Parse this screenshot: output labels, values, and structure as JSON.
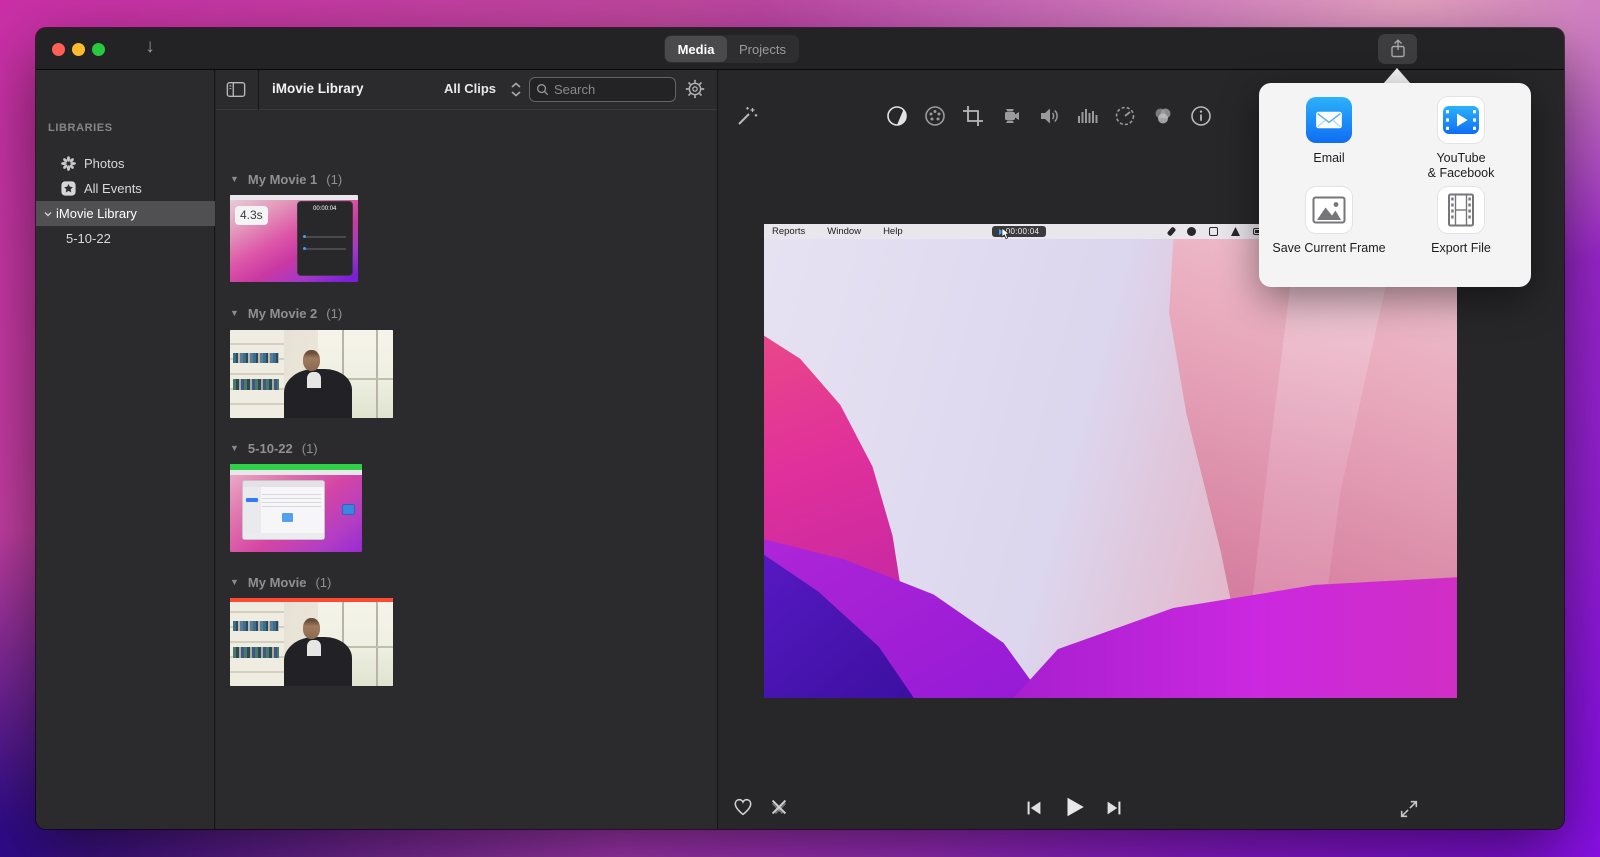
{
  "titlebar": {
    "tabs": [
      {
        "label": "Media"
      },
      {
        "label": "Projects"
      }
    ],
    "active_tab": "Media",
    "download_arrow_glyph": "↓"
  },
  "sidebar": {
    "header": "LIBRARIES",
    "items": [
      {
        "label": "Photos",
        "icon": "photos-pinwheel-icon"
      },
      {
        "label": "All Events",
        "icon": "star-icon"
      },
      {
        "label": "iMovie Library",
        "icon": "chevron-down-icon",
        "selected": true
      },
      {
        "label": "5-10-22",
        "indented": true
      }
    ],
    "star_glyph": "★"
  },
  "media": {
    "title": "iMovie Library",
    "filter_label": "All Clips",
    "search_placeholder": "Search",
    "disclosure_glyph": "▼",
    "sections": [
      {
        "name": "My Movie 1",
        "count": "(1)"
      },
      {
        "name": "My Movie 2",
        "count": "(1)"
      },
      {
        "name": "5-10-22",
        "count": "(1)"
      },
      {
        "name": "My Movie",
        "count": "(1)"
      }
    ],
    "clip1_duration_badge": "4.3s",
    "clip1_window_timer": "00:00:04",
    "used_clip_stripe_color": "#ff4a31",
    "recorded_clip_stripe_color": "#30d148"
  },
  "viewer": {
    "toolbar_icons": [
      "enhance-wand",
      "color-balance",
      "color-palette",
      "crop",
      "stabilization",
      "volume",
      "noise-equalizer",
      "speed",
      "clip-filter",
      "info"
    ],
    "preview": {
      "menus": [
        "Reports",
        "Window",
        "Help"
      ],
      "timer": "00:00:04"
    },
    "controls": [
      "favorite-heart",
      "reject-x",
      "previous-frame",
      "play",
      "next-frame",
      "fullscreen"
    ]
  },
  "share_popover": {
    "items": [
      {
        "label": "Email",
        "icon": "mail-icon"
      },
      {
        "label": "YouTube\n& Facebook",
        "icon": "youtube-facebook-icon"
      },
      {
        "label": "Save Current Frame",
        "icon": "save-frame-icon"
      },
      {
        "label": "Export File",
        "icon": "export-file-icon"
      }
    ]
  },
  "colors": {
    "traffic_red": "#ff5f57",
    "traffic_yellow": "#febc2e",
    "traffic_green": "#28c840",
    "mail_blue": "#0f6df4"
  }
}
